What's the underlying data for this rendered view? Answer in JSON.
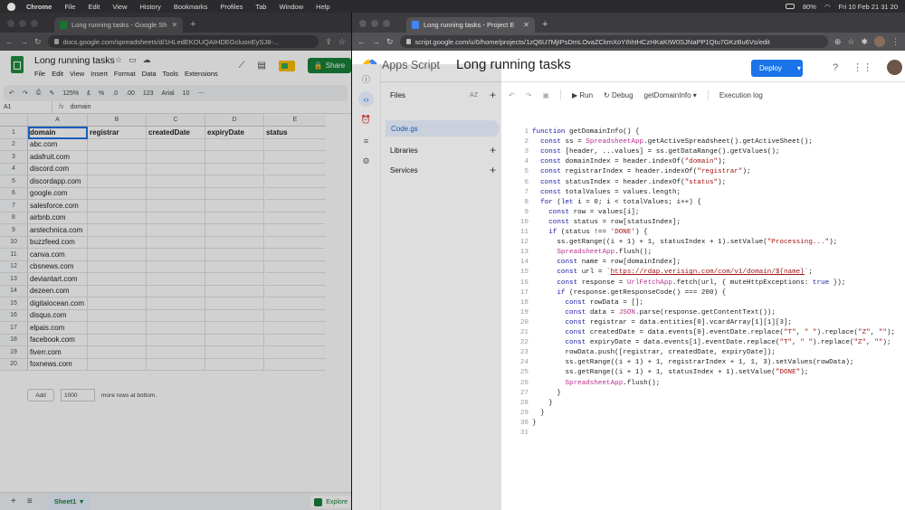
{
  "os_menu": {
    "app": "Chrome",
    "items": [
      "File",
      "Edit",
      "View",
      "History",
      "Bookmarks",
      "Profiles",
      "Tab",
      "Window",
      "Help"
    ],
    "battery": "80%",
    "clock": "Fri 10 Feb  21 31 20"
  },
  "left_window": {
    "tab_title": "Long running tasks - Google Sh",
    "url": "docs.google.com/spreadsheets/d/1HLedEKOUQAIHDEGcluonEySJ8-...",
    "doc_title": "Long running tasks",
    "menu": [
      "File",
      "Edit",
      "View",
      "Insert",
      "Format",
      "Data",
      "Tools",
      "Extensions"
    ],
    "share_label": "Share",
    "toolbar": {
      "zoom": "125%",
      "currency": "£",
      "percent": "%",
      ".0": ".0",
      ".00": ".00",
      "fmt": "123",
      "font": "Arial",
      "size": "10"
    },
    "cell_ref": "A1",
    "formula": "domain",
    "columns": [
      "A",
      "B",
      "C",
      "D",
      "E"
    ],
    "header_row": [
      "domain",
      "registrar",
      "createdDate",
      "expiryDate",
      "status"
    ],
    "domains": [
      "abc.com",
      "adafruit.com",
      "discord.com",
      "discordapp.com",
      "google.com",
      "salesforce.com",
      "airbnb.com",
      "arstechnica.com",
      "buzzfeed.com",
      "canva.com",
      "cbsnews.com",
      "deviantart.com",
      "dezeen.com",
      "digitalocean.com",
      "disqus.com",
      "elpais.com",
      "facebook.com",
      "fiverr.com",
      "foxnews.com"
    ],
    "row_numbers": [
      "1",
      "2",
      "3",
      "4",
      "5",
      "6",
      "7",
      "8",
      "9",
      "10",
      "11",
      "12",
      "13",
      "14",
      "15",
      "16",
      "17",
      "18",
      "19",
      "20"
    ],
    "add_label": "Add",
    "add_rows_value": "1000",
    "add_rows_suffix": "more rows at bottom.",
    "sheet_tab": "Sheet1",
    "explore_label": "Explore"
  },
  "right_window": {
    "tab_title": "Long running tasks - Project E",
    "url": "script.google.com/u/0/home/projects/1zQ6U7MjIPsDmLOvaZCkmXoYIhhtHCzHKaKIW0SJNaPP1Qtu7GKzBu6Vs/edit",
    "brand": "Apps Script",
    "project": "Long running tasks",
    "deploy_label": "Deploy",
    "files_label": "Files",
    "files_sort": "AZ",
    "file_name": "Code.gs",
    "libraries_label": "Libraries",
    "services_label": "Services",
    "run_label": "Run",
    "debug_label": "Debug",
    "function_select": "getDomainInfo",
    "exec_log_label": "Execution log",
    "line_numbers": [
      "1",
      "2",
      "3",
      "4",
      "5",
      "6",
      "7",
      "8",
      "9",
      "10",
      "11",
      "12",
      "13",
      "14",
      "15",
      "16",
      "17",
      "18",
      "19",
      "20",
      "21",
      "22",
      "23",
      "24",
      "25",
      "26",
      "27",
      "28",
      "29",
      "30",
      "31"
    ],
    "code_lines": [
      [
        [
          "kw",
          "function "
        ],
        [
          "",
          "getDomainInfo() {"
        ]
      ],
      [
        [
          "",
          "  "
        ],
        [
          "kw",
          "const "
        ],
        [
          "",
          "ss = "
        ],
        [
          "cls",
          "SpreadsheetApp"
        ],
        [
          "",
          ".getActiveSpreadsheet().getActiveSheet();"
        ]
      ],
      [
        [
          "",
          "  "
        ],
        [
          "kw",
          "const "
        ],
        [
          "",
          "[header, ...values] = ss.getDataRange().getValues();"
        ]
      ],
      [
        [
          "",
          "  "
        ],
        [
          "kw",
          "const "
        ],
        [
          "",
          "domainIndex = header.indexOf("
        ],
        [
          "str",
          "\"domain\""
        ],
        [
          "",
          ");"
        ]
      ],
      [
        [
          "",
          "  "
        ],
        [
          "kw",
          "const "
        ],
        [
          "",
          "registrarIndex = header.indexOf("
        ],
        [
          "str",
          "\"registrar\""
        ],
        [
          "",
          ");"
        ]
      ],
      [
        [
          "",
          "  "
        ],
        [
          "kw",
          "const "
        ],
        [
          "",
          "statusIndex = header.indexOf("
        ],
        [
          "str",
          "\"status\""
        ],
        [
          "",
          ");"
        ]
      ],
      [
        [
          "",
          "  "
        ],
        [
          "kw",
          "const "
        ],
        [
          "",
          "totalValues = values.length;"
        ]
      ],
      [
        [
          "",
          "  "
        ],
        [
          "kw",
          "for "
        ],
        [
          "",
          "("
        ],
        [
          "kw",
          "let "
        ],
        [
          "",
          "i = 0; i < totalValues; i++) {"
        ]
      ],
      [
        [
          "",
          "    "
        ],
        [
          "kw",
          "const "
        ],
        [
          "",
          "row = values[i];"
        ]
      ],
      [
        [
          "",
          "    "
        ],
        [
          "kw",
          "const "
        ],
        [
          "",
          "status = row[statusIndex];"
        ]
      ],
      [
        [
          "",
          "    "
        ],
        [
          "kw",
          "if "
        ],
        [
          "",
          "(status !== "
        ],
        [
          "str",
          "'DONE'"
        ],
        [
          "",
          ") {"
        ]
      ],
      [
        [
          "",
          "      ss.getRange((i + 1) + 1, statusIndex + 1).setValue("
        ],
        [
          "str",
          "\"Processing...\""
        ],
        [
          "",
          ");"
        ]
      ],
      [
        [
          "",
          "      "
        ],
        [
          "cls",
          "SpreadsheetApp"
        ],
        [
          "",
          ".flush();"
        ]
      ],
      [
        [
          "",
          "      "
        ],
        [
          "kw",
          "const "
        ],
        [
          "",
          "name = row[domainIndex];"
        ]
      ],
      [
        [
          "",
          "      "
        ],
        [
          "kw",
          "const "
        ],
        [
          "",
          "url = `"
        ],
        [
          "lnk",
          "https://rdap.verisign.com/com/v1/domain/${name}"
        ],
        [
          "",
          "`;"
        ]
      ],
      [
        [
          "",
          "      "
        ],
        [
          "kw",
          "const "
        ],
        [
          "",
          "response = "
        ],
        [
          "cls",
          "UrlFetchApp"
        ],
        [
          "",
          ".fetch(url, { muteHttpExceptions: "
        ],
        [
          "kw",
          "true"
        ],
        [
          "",
          " });"
        ]
      ],
      [
        [
          "",
          "      "
        ],
        [
          "kw",
          "if "
        ],
        [
          "",
          "(response.getResponseCode() === 200) {"
        ]
      ],
      [
        [
          "",
          "        "
        ],
        [
          "kw",
          "const "
        ],
        [
          "",
          "rowData = [];"
        ]
      ],
      [
        [
          "",
          "        "
        ],
        [
          "kw",
          "const "
        ],
        [
          "",
          "data = "
        ],
        [
          "cls",
          "JSON"
        ],
        [
          "",
          ".parse(response.getContentText());"
        ]
      ],
      [
        [
          "",
          "        "
        ],
        [
          "kw",
          "const "
        ],
        [
          "",
          "registrar = data.entities[0].vcardArray[1][1][3];"
        ]
      ],
      [
        [
          "",
          "        "
        ],
        [
          "kw",
          "const "
        ],
        [
          "",
          "createdDate = data.events[0].eventDate.replace("
        ],
        [
          "str",
          "\"T\""
        ],
        [
          "",
          ", "
        ],
        [
          "str",
          "\" \""
        ],
        [
          "",
          ").replace("
        ],
        [
          "str",
          "\"Z\""
        ],
        [
          "",
          ", "
        ],
        [
          "str",
          "\"\""
        ],
        [
          "",
          ");"
        ]
      ],
      [
        [
          "",
          "        "
        ],
        [
          "kw",
          "const "
        ],
        [
          "",
          "expiryDate = data.events[1].eventDate.replace("
        ],
        [
          "str",
          "\"T\""
        ],
        [
          "",
          ", "
        ],
        [
          "str",
          "\" \""
        ],
        [
          "",
          ").replace("
        ],
        [
          "str",
          "\"Z\""
        ],
        [
          "",
          ", "
        ],
        [
          "str",
          "\"\""
        ],
        [
          "",
          ");"
        ]
      ],
      [
        [
          "",
          "        rowData.push([registrar, createdDate, expiryDate]);"
        ]
      ],
      [
        [
          "",
          "        ss.getRange((i + 1) + 1, registrarIndex + 1, 1, 3).setValues(rowData);"
        ]
      ],
      [
        [
          "",
          "        ss.getRange((i + 1) + 1, statusIndex + 1).setValue("
        ],
        [
          "str",
          "\"DONE\""
        ],
        [
          "",
          ");"
        ]
      ],
      [
        [
          "",
          "        "
        ],
        [
          "cls",
          "SpreadsheetApp"
        ],
        [
          "",
          ".flush();"
        ]
      ],
      [
        [
          "",
          "      }"
        ]
      ],
      [
        [
          "",
          "    }"
        ]
      ],
      [
        [
          "",
          "  }"
        ]
      ],
      [
        [
          "",
          "}"
        ]
      ],
      [
        [
          "",
          ""
        ]
      ]
    ]
  }
}
